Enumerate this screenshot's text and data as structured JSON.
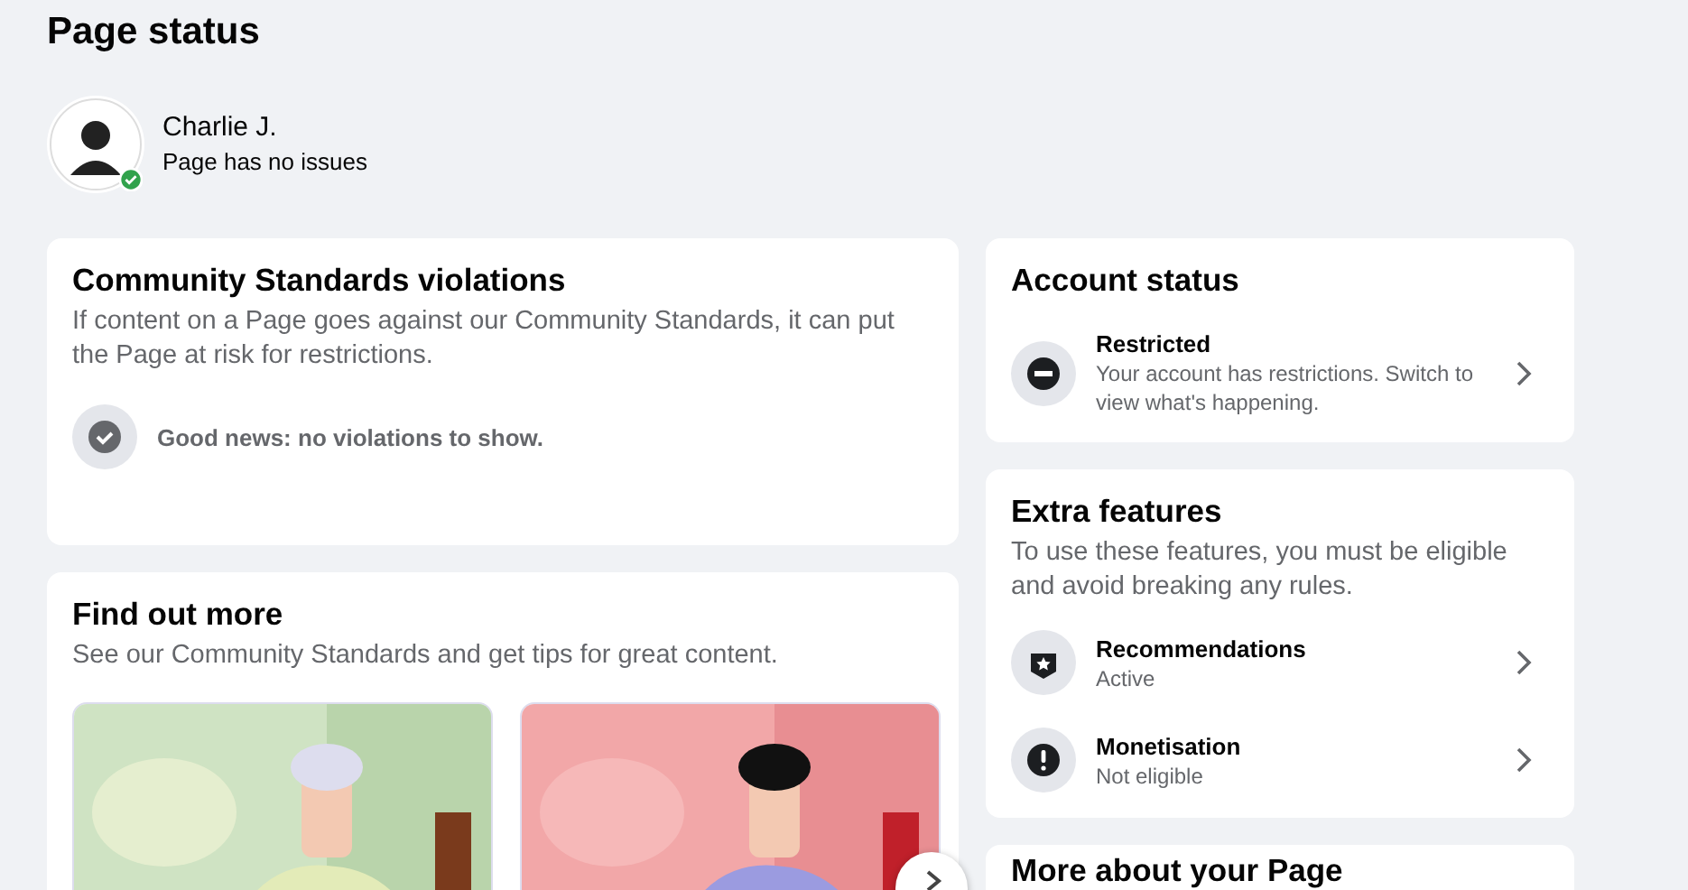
{
  "page": {
    "title": "Page status"
  },
  "profile": {
    "name": "Charlie J.",
    "status": "Page has no issues",
    "verified": true
  },
  "violations": {
    "title": "Community Standards violations",
    "description": "If content on a Page goes against our Community Standards, it can put the Page at risk for restrictions.",
    "notice": "Good news: no violations to show."
  },
  "find_out_more": {
    "title": "Find out more",
    "description": "See our Community Standards and get tips for great content."
  },
  "account_status": {
    "title": "Account status",
    "items": [
      {
        "kind": "restricted",
        "title": "Restricted",
        "subtitle": "Your account has restrictions. Switch to view what's happening."
      }
    ]
  },
  "extra_features": {
    "title": "Extra features",
    "description": "To use these features, you must be eligible and avoid breaking any rules.",
    "items": [
      {
        "kind": "badge",
        "title": "Recommendations",
        "subtitle": "Active"
      },
      {
        "kind": "alert",
        "title": "Monetisation",
        "subtitle": "Not eligible"
      }
    ]
  },
  "more_about": {
    "title": "More about your Page"
  }
}
